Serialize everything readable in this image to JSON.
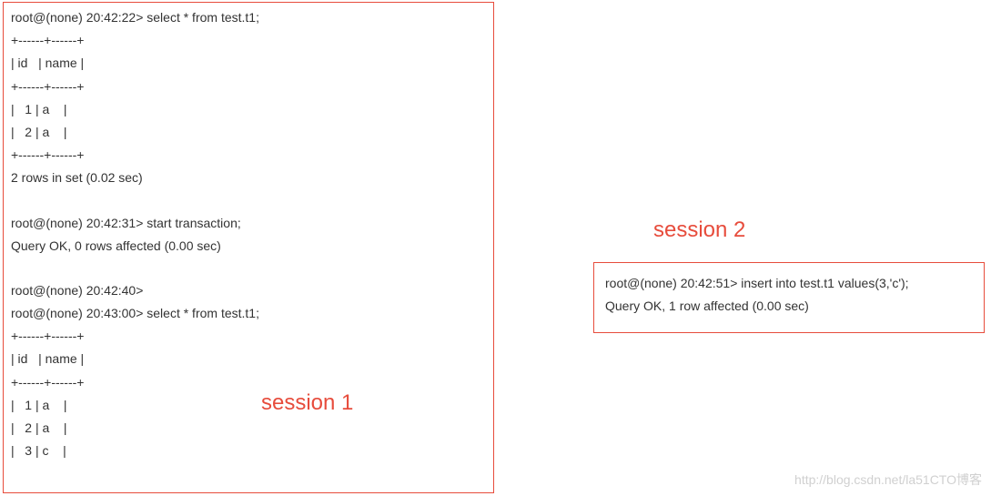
{
  "session1": {
    "label": "session 1",
    "lines": [
      "root@(none) 20:42:22> select * from test.t1;",
      "+------+------+",
      "| id   | name |",
      "+------+------+",
      "|   1 | a    |",
      "|   2 | a    |",
      "+------+------+",
      "2 rows in set (0.02 sec)",
      "",
      "root@(none) 20:42:31> start transaction;",
      "Query OK, 0 rows affected (0.00 sec)",
      "",
      "root@(none) 20:42:40>",
      "root@(none) 20:43:00> select * from test.t1;",
      "+------+------+",
      "| id   | name |",
      "+------+------+",
      "|   1 | a    |",
      "|   2 | a    |",
      "|   3 | c    |"
    ]
  },
  "session2": {
    "label": "session 2",
    "lines": [
      "root@(none) 20:42:51> insert into test.t1 values(3,'c');",
      "Query OK, 1 row affected (0.00 sec)"
    ]
  },
  "watermark": "http://blog.csdn.net/la51CTO博客"
}
